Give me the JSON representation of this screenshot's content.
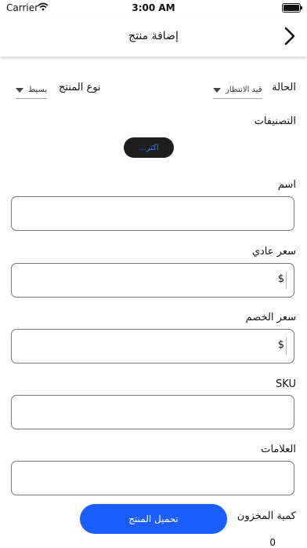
{
  "status_bar": {
    "carrier": "Carrier",
    "time": "3:00 AM",
    "icons": [
      "wifi-icon",
      "battery-icon"
    ]
  },
  "nav": {
    "title": "إضافة منتج",
    "back_icon": "chevron-right-icon"
  },
  "status": {
    "label": "الحالة",
    "value": "قيد الانتظار"
  },
  "product_type": {
    "label": "نوع المنتج",
    "value": "بسيط"
  },
  "categories": {
    "label": "التصنيفات",
    "more_button": "...اكثر"
  },
  "fields": {
    "name": {
      "label": "اسم",
      "value": ""
    },
    "regular_price": {
      "label": "سعر عادي",
      "prefix": "$",
      "value": ""
    },
    "sale_price": {
      "label": "سعر الخصم",
      "prefix": "$",
      "value": ""
    },
    "sku": {
      "label": "SKU",
      "value": ""
    },
    "tags": {
      "label": "العلامات",
      "value": ""
    },
    "stock_quantity": {
      "label": "كمية المخزون",
      "value": "0"
    }
  },
  "upload_button": "تحميل المنتج",
  "colors": {
    "accent": "#1a5eff",
    "pill_bg": "#1e1e1e",
    "pill_text": "#2f83ff"
  }
}
